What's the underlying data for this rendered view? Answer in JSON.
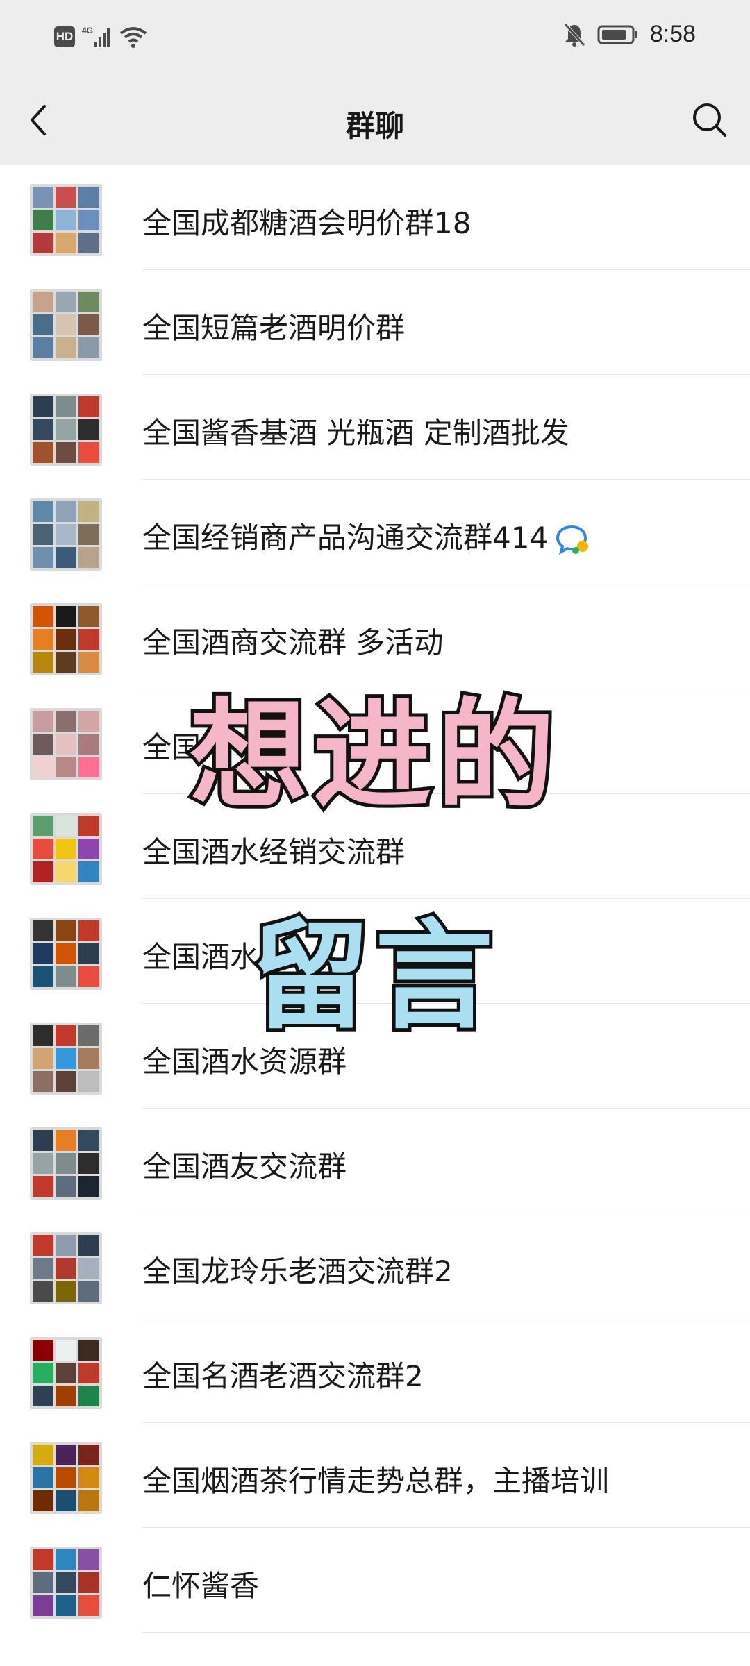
{
  "status_bar": {
    "hd_label": "HD",
    "network_label": "4G",
    "time": "8:58",
    "icons": [
      "hd-icon",
      "signal-icon",
      "wifi-icon",
      "mute-bell-icon",
      "battery-icon"
    ]
  },
  "navbar": {
    "title": "群聊",
    "back_icon": "chevron-left-icon",
    "search_icon": "search-icon"
  },
  "groups": [
    {
      "name": "全国成都糖酒会明价群18"
    },
    {
      "name": "全国短篇老酒明价群"
    },
    {
      "name": "全国酱香基酒 光瓶酒 定制酒批发"
    },
    {
      "name": "全国经销商产品沟通交流群414",
      "badge_icon": "chat-bubble-icon"
    },
    {
      "name": "全国酒商交流群  多活动"
    },
    {
      "name": "全国"
    },
    {
      "name": "全国酒水经销交流群"
    },
    {
      "name": "全国酒水"
    },
    {
      "name": "全国酒水资源群"
    },
    {
      "name": "全国酒友交流群"
    },
    {
      "name": "全国龙玲乐老酒交流群2"
    },
    {
      "name": "全国名酒老酒交流群2"
    },
    {
      "name": "全国烟酒茶行情走势总群，主播培训"
    },
    {
      "name": "仁怀酱香"
    }
  ],
  "overlay": {
    "line1": "想进的",
    "line2": "留言"
  },
  "colors": {
    "bar_bg": "#ededed",
    "list_bg": "#ffffff",
    "divider": "#e6e6e6",
    "overlay_pink": "#f4b6c8",
    "overlay_blue": "#a9dff0"
  }
}
